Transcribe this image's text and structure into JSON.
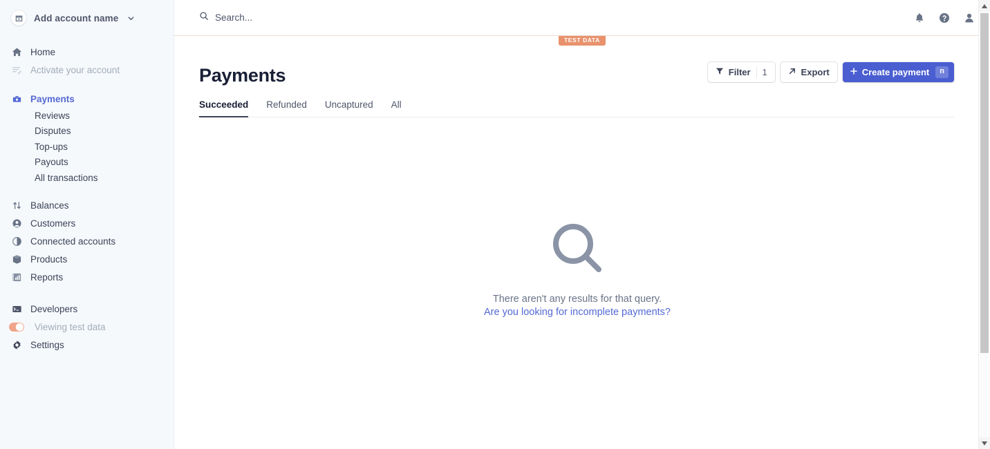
{
  "sidebar": {
    "account": {
      "name": "Add account name",
      "avatar_icon": "store-icon",
      "caret_icon": "chevron-down-icon"
    },
    "primary": [
      {
        "label": "Home",
        "icon": "home-icon",
        "state": "normal"
      },
      {
        "label": "Activate your account",
        "icon": "activate-icon",
        "state": "muted"
      }
    ],
    "payments": {
      "label": "Payments",
      "icon": "payments-icon",
      "state": "active"
    },
    "payments_sub": [
      {
        "label": "Reviews"
      },
      {
        "label": "Disputes"
      },
      {
        "label": "Top-ups"
      },
      {
        "label": "Payouts"
      },
      {
        "label": "All transactions"
      }
    ],
    "secondary": [
      {
        "label": "Balances",
        "icon": "balances-icon"
      },
      {
        "label": "Customers",
        "icon": "customers-icon"
      },
      {
        "label": "Connected accounts",
        "icon": "connected-accounts-icon"
      },
      {
        "label": "Products",
        "icon": "products-icon"
      },
      {
        "label": "Reports",
        "icon": "reports-icon"
      }
    ],
    "tertiary": [
      {
        "label": "Developers",
        "icon": "developers-icon"
      }
    ],
    "test_toggle": {
      "label": "Viewing test data",
      "on": true,
      "color": "#f0a58b"
    },
    "settings": {
      "label": "Settings",
      "icon": "gear-icon"
    }
  },
  "topbar": {
    "search": {
      "placeholder": "Search...",
      "value": "",
      "icon": "search-icon"
    },
    "icons": [
      {
        "name": "bell-icon"
      },
      {
        "name": "help-circle-icon"
      },
      {
        "name": "user-icon"
      }
    ]
  },
  "test_banner": {
    "label": "TEST DATA",
    "color": "#e8926d"
  },
  "page": {
    "title": "Payments",
    "tabs": [
      {
        "label": "Succeeded",
        "active": true
      },
      {
        "label": "Refunded",
        "active": false
      },
      {
        "label": "Uncaptured",
        "active": false
      },
      {
        "label": "All",
        "active": false
      }
    ],
    "actions": {
      "filter": {
        "label": "Filter",
        "count": "1",
        "icon": "funnel-icon"
      },
      "export": {
        "label": "Export",
        "icon": "arrow-up-right-icon"
      },
      "create": {
        "label": "Create payment",
        "shortcut": "n",
        "icon": "plus-icon",
        "color": "#4a5ed1"
      }
    },
    "empty_state": {
      "icon": "magnifier-icon",
      "message": "There aren't any results for that query.",
      "link": "Are you looking for incomplete payments?"
    }
  },
  "scrollbar": {
    "up_icon": "triangle-up-icon",
    "down_icon": "triangle-down-icon"
  }
}
